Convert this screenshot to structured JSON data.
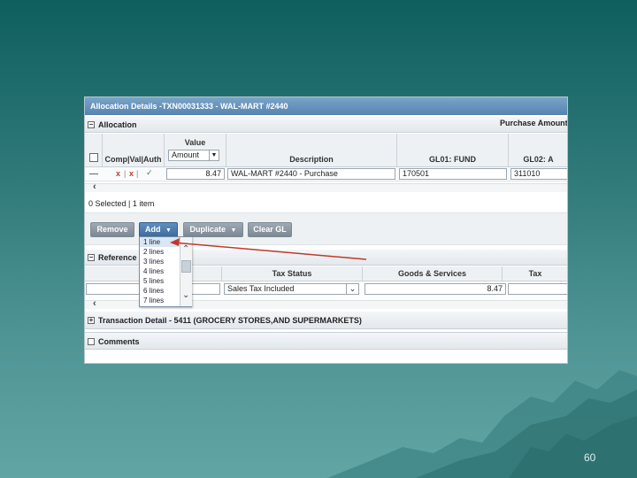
{
  "window": {
    "title": "Allocation Details -TXN00031333 - WAL-MART #2440"
  },
  "allocation": {
    "section_label": "Allocation",
    "purchase_amounts_label": "Purchase Amounts",
    "columns": {
      "comp_val_auth": "Comp|Val|Auth",
      "value": "Value",
      "value_select": "Amount",
      "description": "Description",
      "gl01": "GL01: FUND",
      "gl02": "GL02: A"
    },
    "row": {
      "x_mark_1": "x",
      "x_mark_2": "x",
      "check_mark": "✓",
      "amount": "8.47",
      "description": "WAL-MART #2440 - Purchase",
      "gl01": "170501",
      "gl02": "311010"
    },
    "selection_status": "0 Selected | 1 item"
  },
  "buttons": {
    "remove": "Remove",
    "add": "Add",
    "duplicate": "Duplicate",
    "clear_gl": "Clear GL"
  },
  "add_menu": {
    "items": [
      "1 line",
      "2 lines",
      "3 lines",
      "4 lines",
      "5 lines",
      "6 lines",
      "7 lines"
    ]
  },
  "reference": {
    "section_label": "Reference",
    "columns": {
      "r": "R",
      "tax_status": "Tax Status",
      "goods_services": "Goods & Services",
      "tax": "Tax"
    },
    "row": {
      "tax_status_value": "Sales Tax Included",
      "goods_services_value": "8.47"
    }
  },
  "transaction_detail": {
    "section_label": "Transaction Detail - 5411 (GROCERY STORES,AND SUPERMARKETS)"
  },
  "comments": {
    "section_label": "Comments"
  },
  "slide": {
    "number": "60"
  },
  "colors": {
    "background_top": "#0f5f5f",
    "background_bottom": "#62a5a5",
    "titlebar": "#5683b0",
    "arrow": "#c0392b"
  }
}
